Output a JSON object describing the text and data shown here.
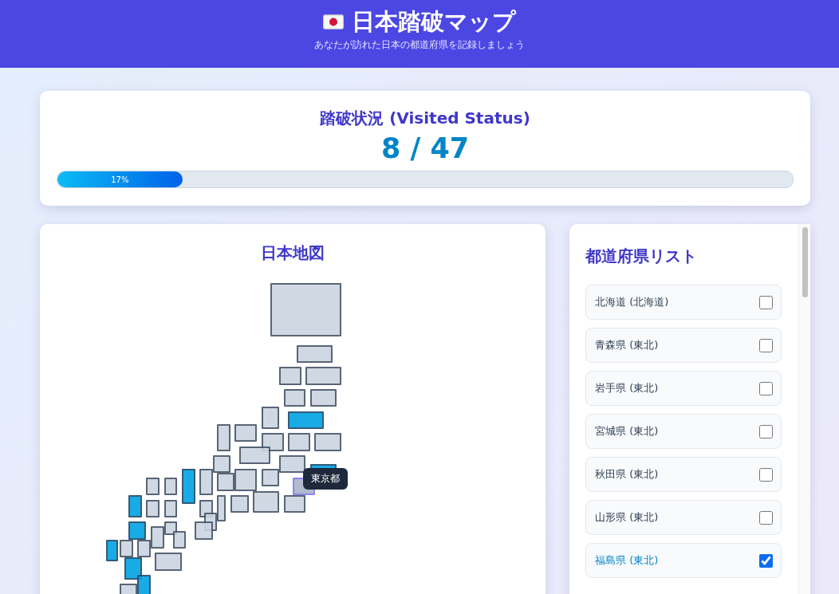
{
  "header": {
    "title": "日本踏破マップ",
    "subtitle": "あなたが訪れた日本の都道府県を記録しましょう"
  },
  "stats": {
    "title": "踏破状況 (Visited Status)",
    "count": "8 / 47",
    "progress": {
      "level": 0.17,
      "label": "17%"
    }
  },
  "map": {
    "title": "日本地図",
    "tooltip": "東京都",
    "tiles": [
      {
        "visited": false,
        "hovered": false
      },
      {
        "visited": false,
        "hovered": false
      },
      {
        "visited": false,
        "hovered": false
      },
      {
        "visited": false,
        "hovered": false
      },
      {
        "visited": false,
        "hovered": false
      },
      {
        "visited": false,
        "hovered": false
      },
      {
        "visited": false,
        "hovered": false
      },
      {
        "visited": true,
        "hovered": false
      },
      {
        "visited": false,
        "hovered": false
      },
      {
        "visited": false,
        "hovered": false
      },
      {
        "visited": false,
        "hovered": false
      },
      {
        "visited": false,
        "hovered": false
      },
      {
        "visited": false,
        "hovered": false
      },
      {
        "visited": false,
        "hovered": false
      },
      {
        "visited": false,
        "hovered": false
      },
      {
        "visited": false,
        "hovered": false
      },
      {
        "visited": true,
        "hovered": false
      },
      {
        "visited": true,
        "hovered": false
      },
      {
        "visited": false,
        "hovered": false
      },
      {
        "visited": false,
        "hovered": false
      },
      {
        "visited": false,
        "hovered": false
      },
      {
        "visited": false,
        "hovered": false
      },
      {
        "visited": false,
        "hovered": true
      },
      {
        "visited": false,
        "hovered": false
      },
      {
        "visited": false,
        "hovered": false
      },
      {
        "visited": true,
        "hovered": false
      },
      {
        "visited": false,
        "hovered": false
      },
      {
        "visited": false,
        "hovered": false
      },
      {
        "visited": false,
        "hovered": false
      },
      {
        "visited": false,
        "hovered": false
      },
      {
        "visited": false,
        "hovered": false
      },
      {
        "visited": false,
        "hovered": false
      },
      {
        "visited": false,
        "hovered": false
      },
      {
        "visited": false,
        "hovered": false
      },
      {
        "visited": false,
        "hovered": false
      },
      {
        "visited": true,
        "hovered": false
      },
      {
        "visited": false,
        "hovered": false
      },
      {
        "visited": false,
        "hovered": false
      },
      {
        "visited": false,
        "hovered": false
      },
      {
        "visited": true,
        "hovered": false
      },
      {
        "visited": false,
        "hovered": false
      },
      {
        "visited": false,
        "hovered": false
      },
      {
        "visited": false,
        "hovered": false
      },
      {
        "visited": true,
        "hovered": false
      },
      {
        "visited": true,
        "hovered": false
      },
      {
        "visited": false,
        "hovered": false
      }
    ]
  },
  "list": {
    "title": "都道府県リスト",
    "items": [
      {
        "label": "北海道 (北海道)",
        "checked": false
      },
      {
        "label": "青森県 (東北)",
        "checked": false
      },
      {
        "label": "岩手県 (東北)",
        "checked": false
      },
      {
        "label": "宮城県 (東北)",
        "checked": false
      },
      {
        "label": "秋田県 (東北)",
        "checked": false
      },
      {
        "label": "山形県 (東北)",
        "checked": false
      },
      {
        "label": "福島県 (東北)",
        "checked": true
      }
    ]
  }
}
